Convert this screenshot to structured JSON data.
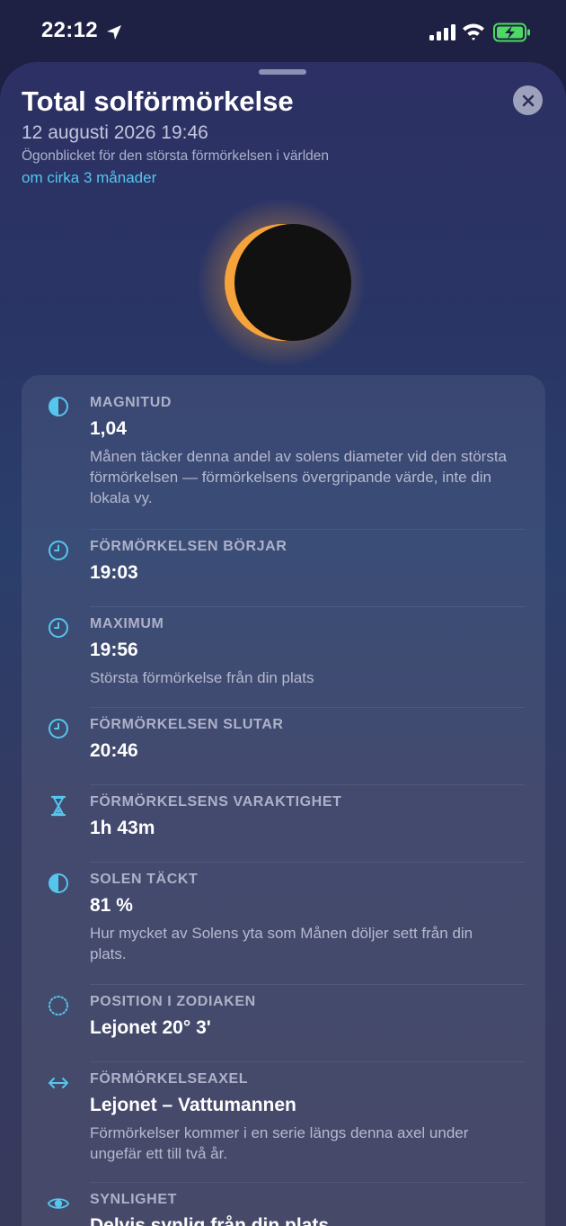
{
  "status_bar": {
    "time": "22:12"
  },
  "sheet": {
    "title": "Total solförmörkelse",
    "date_time": "12 augusti 2026 19:46",
    "caption": "Ögonblicket för den största förmörkelsen i världen",
    "countdown": "om cirka 3 månader"
  },
  "details": [
    {
      "icon": "half-circle-icon",
      "label": "MAGNITUD",
      "value": "1,04",
      "description": "Månen täcker denna andel av solens diameter vid den största förmörkelsen — förmörkelsens övergripande värde, inte din lokala vy."
    },
    {
      "icon": "clock-icon",
      "label": "FÖRMÖRKELSEN BÖRJAR",
      "value": "19:03"
    },
    {
      "icon": "clock-icon",
      "label": "MAXIMUM",
      "value": "19:56",
      "description": "Största förmörkelse från din plats"
    },
    {
      "icon": "clock-icon",
      "label": "FÖRMÖRKELSEN SLUTAR",
      "value": "20:46"
    },
    {
      "icon": "hourglass-icon",
      "label": "FÖRMÖRKELSENS VARAKTIGHET",
      "value": "1h 43m"
    },
    {
      "icon": "half-circle-icon",
      "label": "SOLEN TÄCKT",
      "value": "81 %",
      "description": "Hur mycket av Solens yta som Månen döljer sett från din plats."
    },
    {
      "icon": "dotted-circle-icon",
      "label": "POSITION I ZODIAKEN",
      "value": "Lejonet 20° 3'"
    },
    {
      "icon": "double-arrow-icon",
      "label": "FÖRMÖRKELSEAXEL",
      "value": "Lejonet – Vattumannen",
      "description": "Förmörkelser kommer i en serie längs denna axel under ungefär ett till två år."
    },
    {
      "icon": "eye-icon",
      "label": "SYNLIGHET",
      "value": "Delvis synlig från din plats"
    }
  ],
  "colors": {
    "accent": "#55c6ee",
    "sun_corona": "#f5a33a",
    "battery_charging": "#4cd964"
  }
}
